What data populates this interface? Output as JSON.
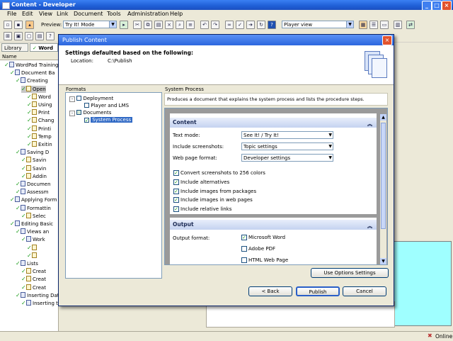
{
  "window": {
    "title": "Content - Developer"
  },
  "menu": [
    "File",
    "Edit",
    "View",
    "Link",
    "Document",
    "Tools",
    "Administration",
    "Help"
  ],
  "toolbar": {
    "preview_label": "Preview:",
    "preview_value": "Try It! Mode",
    "player_view": "Player view"
  },
  "left_tabs": {
    "library": "Library",
    "word": "Word"
  },
  "tree": {
    "header": "Name",
    "items": [
      "WordPad Training",
      "Document Ba",
      "Creating",
      "Open",
      "Word",
      "Using",
      "Print",
      "Chang",
      "Printi",
      "Temp",
      "Exitin",
      "Saving D",
      "Savin",
      "Savin",
      "Addin",
      "Documen",
      "Assessm",
      "Applying Form",
      "Formattin",
      "Selec",
      "Editing Basic",
      "Views an",
      "Work",
      "",
      "",
      "Lists",
      "Creat",
      "Creat",
      "Creat",
      "Inserting Dates and Objects",
      "Inserting the Date"
    ]
  },
  "status": {
    "online": "Online"
  },
  "dialog": {
    "title": "Publish Content",
    "header_title": "Settings defaulted based on the following:",
    "location_label": "Location:",
    "location_value": "C:\\Publish",
    "formats_label": "Formats",
    "formats_tree": [
      "Deployment",
      "Player and LMS",
      "Documents",
      "System Process"
    ],
    "section_title": "System Process",
    "section_desc": "Produces a document that explains the system process and lists the procedure steps.",
    "content_header": "Content",
    "text_mode_label": "Text mode:",
    "text_mode_value": "See It! / Try It!",
    "include_screenshots_label": "Include screenshots:",
    "include_screenshots_value": "Topic settings",
    "web_page_format_label": "Web page format:",
    "web_page_format_value": "Developer settings",
    "options": [
      "Convert screenshots to 256 colors",
      "Include alternatives",
      "Include images from packages",
      "Include images in web pages",
      "Include relative links"
    ],
    "output_header": "Output",
    "output_format_label": "Output format:",
    "output_formats": [
      "Microsoft Word",
      "Adobe PDF",
      "HTML Web Page"
    ],
    "use_options_button": "Use Options Settings",
    "back_button": "< Back",
    "publish_button": "Publish",
    "cancel_button": "Cancel"
  }
}
